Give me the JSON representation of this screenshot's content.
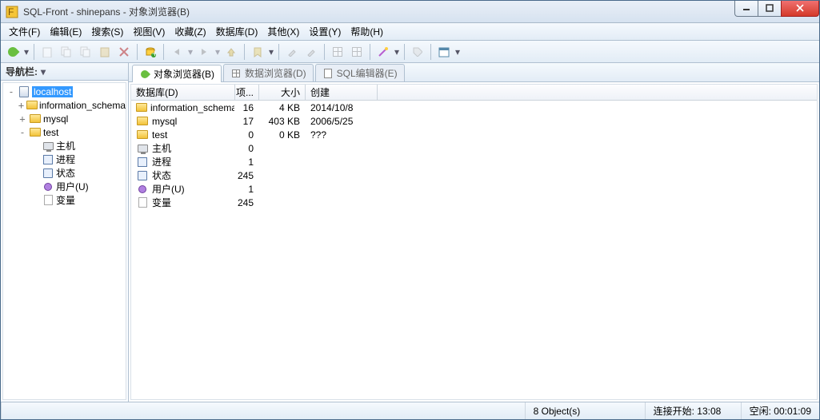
{
  "window": {
    "title": "SQL-Front - shinepans - 对象浏览器(B)"
  },
  "menubar": {
    "file": "文件(F)",
    "edit": "编辑(E)",
    "search": "搜索(S)",
    "view": "视图(V)",
    "fav": "收藏(Z)",
    "db": "数据库(D)",
    "other": "其他(X)",
    "settings": "设置(Y)",
    "help": "帮助(H)"
  },
  "nav": {
    "header": "导航栏:",
    "root": "localhost",
    "children": [
      {
        "label": "information_schema",
        "icon": "db",
        "exp": "+"
      },
      {
        "label": "mysql",
        "icon": "db",
        "exp": "+"
      },
      {
        "label": "test",
        "icon": "db",
        "exp": "-"
      },
      {
        "label": "主机",
        "icon": "host",
        "exp": "",
        "lvl": 3
      },
      {
        "label": "进程",
        "icon": "proc",
        "exp": "",
        "lvl": 3
      },
      {
        "label": "状态",
        "icon": "stat",
        "exp": "",
        "lvl": 3
      },
      {
        "label": "用户(U)",
        "icon": "user",
        "exp": "",
        "lvl": 3
      },
      {
        "label": "变量",
        "icon": "var",
        "exp": "",
        "lvl": 3
      }
    ]
  },
  "tabs": {
    "obj": "对象浏览器(B)",
    "data": "数据浏览器(D)",
    "sql": "SQL编辑器(E)"
  },
  "columns": {
    "name": "数据库(D)",
    "count": "项...",
    "size": "大小",
    "created": "创建"
  },
  "rows": [
    {
      "name": "information_schema",
      "icon": "db",
      "count": "16",
      "size": "4 KB",
      "created": "2014/10/8"
    },
    {
      "name": "mysql",
      "icon": "db",
      "count": "17",
      "size": "403 KB",
      "created": "2006/5/25"
    },
    {
      "name": "test",
      "icon": "db",
      "count": "0",
      "size": "0 KB",
      "created": "???"
    },
    {
      "name": "主机",
      "icon": "host",
      "count": "0",
      "size": "",
      "created": ""
    },
    {
      "name": "进程",
      "icon": "proc",
      "count": "1",
      "size": "",
      "created": ""
    },
    {
      "name": "状态",
      "icon": "stat",
      "count": "245",
      "size": "",
      "created": ""
    },
    {
      "name": "用户(U)",
      "icon": "user",
      "count": "1",
      "size": "",
      "created": ""
    },
    {
      "name": "变量",
      "icon": "var",
      "count": "245",
      "size": "",
      "created": ""
    }
  ],
  "status": {
    "objects": "8 Object(s)",
    "conn": "连接开始: 13:08",
    "idle": "空闲: 00:01:09"
  }
}
